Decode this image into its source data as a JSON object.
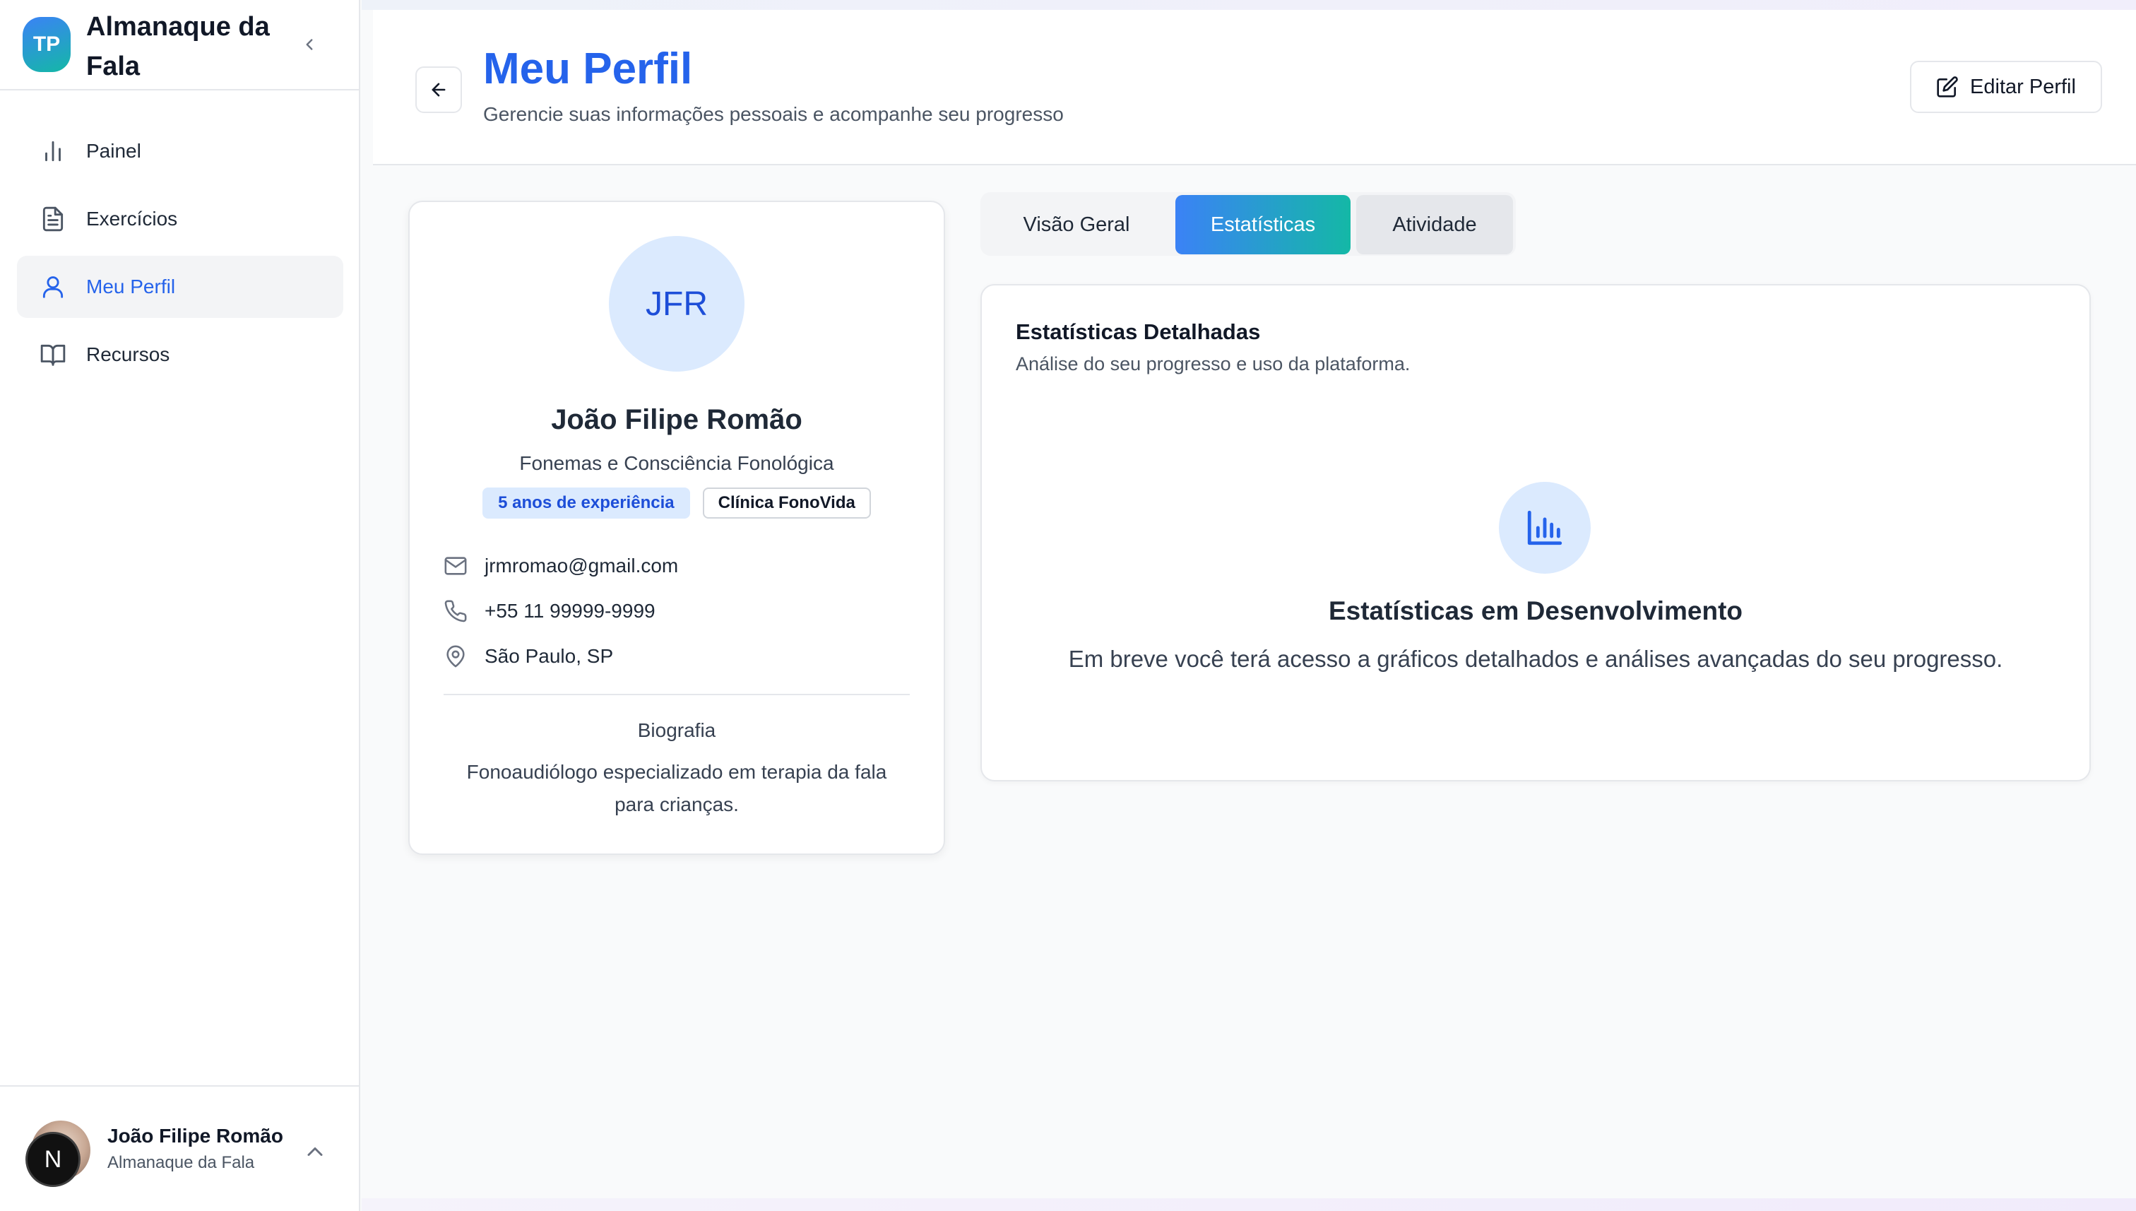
{
  "app": {
    "logo_initials": "TP",
    "title": "Almanaque da Fala",
    "accent_color": "#2563eb",
    "gradient": [
      "#3b82f6",
      "#14b8a6"
    ]
  },
  "sidebar": {
    "items": [
      {
        "label": "Painel",
        "icon": "bar-chart-icon",
        "active": false
      },
      {
        "label": "Exercícios",
        "icon": "document-icon",
        "active": false
      },
      {
        "label": "Meu Perfil",
        "icon": "user-icon",
        "active": true
      },
      {
        "label": "Recursos",
        "icon": "book-icon",
        "active": false
      }
    ],
    "footer": {
      "avatar_letter": "N",
      "name": "João Filipe Romão",
      "subtitle": "Almanaque da Fala"
    }
  },
  "header": {
    "title": "Meu Perfil",
    "subtitle": "Gerencie suas informações pessoais e acompanhe seu progresso",
    "edit_label": "Editar Perfil"
  },
  "profile": {
    "initials": "JFR",
    "name": "João Filipe Romão",
    "specialty": "Fonemas e Consciência Fonológica",
    "badge_experience": "5 anos de experiência",
    "badge_clinic": "Clínica FonoVida",
    "email": "jrmromao@gmail.com",
    "phone": "+55 11 99999-9999",
    "location": "São Paulo, SP",
    "bio_title": "Biografia",
    "bio_text": "Fonoaudiólogo especializado em terapia da fala para crianças."
  },
  "tabs": [
    {
      "label": "Visão Geral",
      "active": false
    },
    {
      "label": "Estatísticas",
      "active": true
    },
    {
      "label": "Atividade",
      "active": false
    }
  ],
  "stats": {
    "title": "Estatísticas Detalhadas",
    "subtitle": "Análise do seu progresso e uso da plataforma.",
    "placeholder_title": "Estatísticas em Desenvolvimento",
    "placeholder_text": "Em breve você terá acesso a gráficos detalhados e análises avançadas do seu progresso."
  }
}
